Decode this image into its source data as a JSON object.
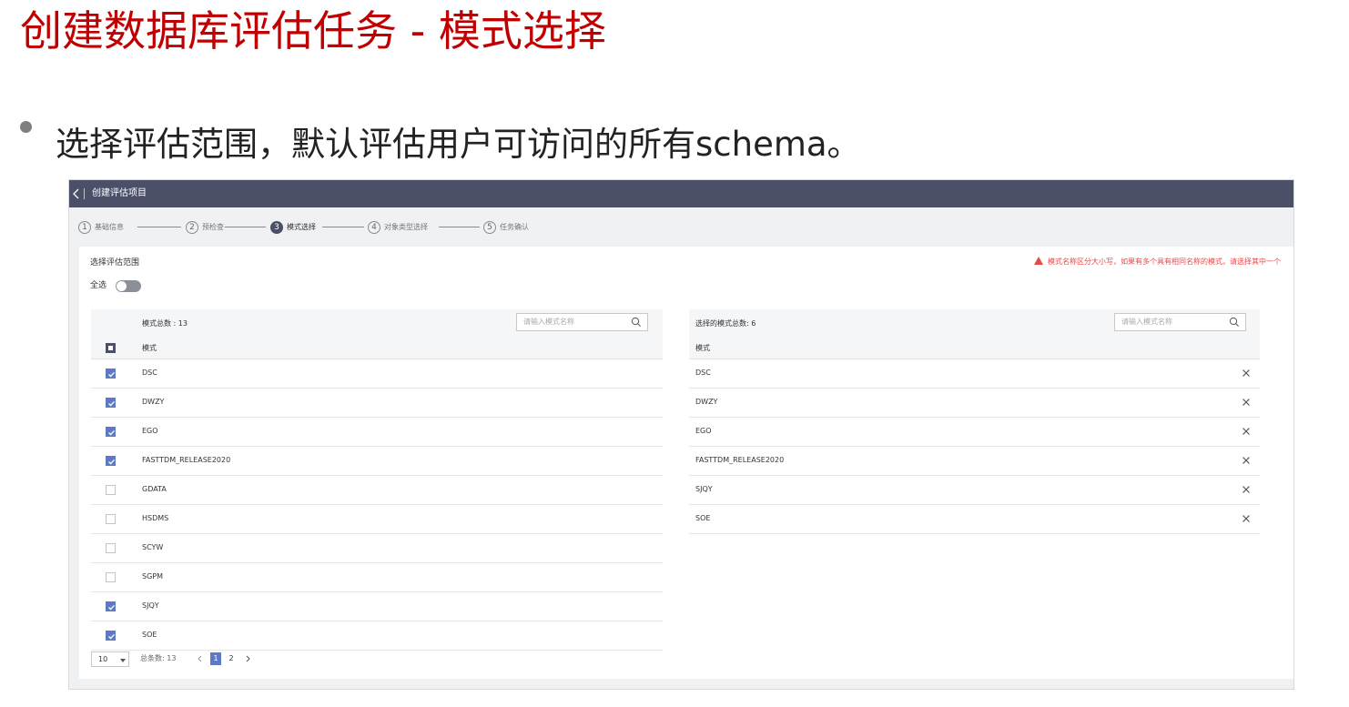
{
  "slide": {
    "title": "创建数据库评估任务 - 模式选择",
    "bullet": "选择评估范围，默认评估用户可访问的所有schema。"
  },
  "app": {
    "header_title": "创建评估项目",
    "steps": [
      {
        "num": "1",
        "label": "基础信息",
        "state": "done"
      },
      {
        "num": "2",
        "label": "预检查",
        "state": "done"
      },
      {
        "num": "3",
        "label": "模式选择",
        "state": "active"
      },
      {
        "num": "4",
        "label": "对象类型选择",
        "state": "todo"
      },
      {
        "num": "5",
        "label": "任务确认",
        "state": "todo"
      }
    ],
    "scope_label": "选择评估范围",
    "warning": "模式名称区分大小写，如果有多个具有相同名称的模式，请选择其中一个",
    "select_all_label": "全选",
    "select_all_on": false,
    "left": {
      "count_label": "模式总数 : 13",
      "search_placeholder": "请输入模式名称",
      "column": "模式",
      "rows": [
        {
          "name": "DSC",
          "checked": true
        },
        {
          "name": "DWZY",
          "checked": true
        },
        {
          "name": "EGO",
          "checked": true
        },
        {
          "name": "FASTTDM_RELEASE2020",
          "checked": true
        },
        {
          "name": "GDATA",
          "checked": false
        },
        {
          "name": "HSDMS",
          "checked": false
        },
        {
          "name": "SCYW",
          "checked": false
        },
        {
          "name": "SGPM",
          "checked": false
        },
        {
          "name": "SJQY",
          "checked": true
        },
        {
          "name": "SOE",
          "checked": true
        }
      ]
    },
    "right": {
      "count_label": "选择的模式总数: 6",
      "search_placeholder": "请输入模式名称",
      "column": "模式",
      "rows": [
        "DSC",
        "DWZY",
        "EGO",
        "FASTTDM_RELEASE2020",
        "SJQY",
        "SOE"
      ]
    },
    "pager": {
      "page_size": "10",
      "total": "总条数: 13",
      "pages": [
        "1",
        "2"
      ],
      "current_page": "1"
    },
    "colors": {
      "header": "#4b5068",
      "accent": "#5d7bc5",
      "warning": "#e84a4a",
      "title_red": "#c00000"
    }
  }
}
